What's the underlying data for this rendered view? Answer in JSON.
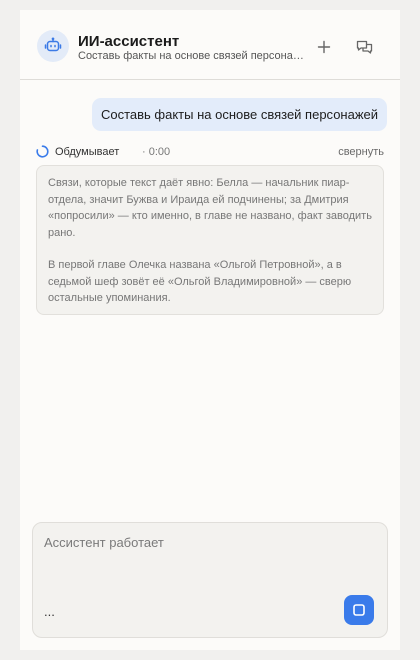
{
  "header": {
    "title": "ИИ-ассистент",
    "subtitle": "Составь факты на основе связей персонажей",
    "avatar_icon": "robot-icon",
    "new_chat_icon": "plus-icon",
    "history_icon": "chat-bubbles-icon"
  },
  "messages": {
    "user_message": "Составь факты на основе связей персонажей"
  },
  "thinking": {
    "label": "Обдумывает",
    "time": "· 0:00",
    "collapse_label": "свернуть",
    "paragraphs": [
      "Связи, которые текст даёт явно: Белла — начальник пиар-отдела, значит Бужва и Ираида ей подчинены; за Дмитрия «попросили» — кто именно, в главе не названо, факт заводить рано.",
      "В первой главе Олечка названа «Ольгой Петровной», а в седьмой шеф зовёт её «Ольгой Владимировной» — сверю остальные упоминания."
    ]
  },
  "composer": {
    "placeholder": "Ассистент работает",
    "status_dots": "...",
    "stop_icon": "stop-icon"
  },
  "colors": {
    "accent": "#3a7bea",
    "user_bubble": "#e3ecfa",
    "background": "#fcfbf9"
  }
}
